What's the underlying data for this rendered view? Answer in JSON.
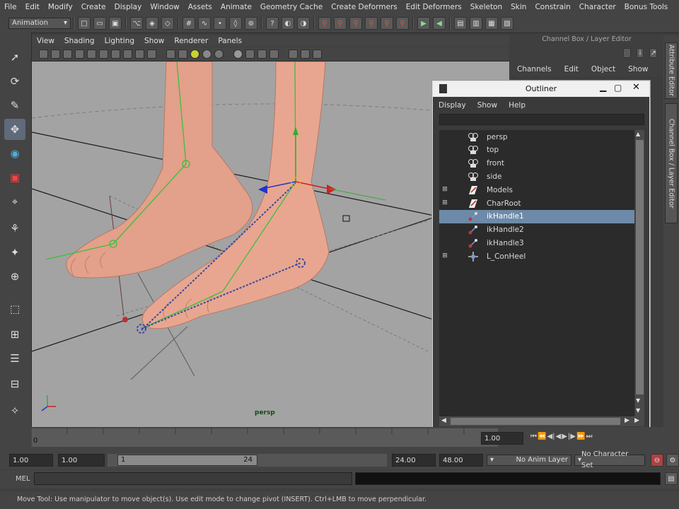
{
  "menubar": [
    "File",
    "Edit",
    "Modify",
    "Create",
    "Display",
    "Window",
    "Assets",
    "Animate",
    "Geometry Cache",
    "Create Deformers",
    "Edit Deformers",
    "Skeleton",
    "Skin",
    "Constrain",
    "Character",
    "Bonus Tools"
  ],
  "statusline": {
    "menuset": "Animation"
  },
  "panel": {
    "menus": [
      "View",
      "Shading",
      "Lighting",
      "Show",
      "Renderer",
      "Panels"
    ],
    "camera_label": "persp"
  },
  "channelbox": {
    "title": "Channel Box / Layer Editor",
    "menus": [
      "Channels",
      "Edit",
      "Object",
      "Show"
    ]
  },
  "side_tabs": [
    "Attribute Editor",
    "Channel Box / Layer Editor"
  ],
  "outliner": {
    "title": "Outliner",
    "menus": [
      "Display",
      "Show",
      "Help"
    ],
    "items": [
      {
        "label": "persp",
        "icon": "camera-icon",
        "expand": false,
        "selected": false
      },
      {
        "label": "top",
        "icon": "camera-icon",
        "expand": false,
        "selected": false
      },
      {
        "label": "front",
        "icon": "camera-icon",
        "expand": false,
        "selected": false
      },
      {
        "label": "side",
        "icon": "camera-icon",
        "expand": false,
        "selected": false
      },
      {
        "label": "Models",
        "icon": "group-icon",
        "expand": true,
        "selected": false
      },
      {
        "label": "CharRoot",
        "icon": "group-icon",
        "expand": true,
        "selected": false
      },
      {
        "label": "ikHandle1",
        "icon": "ik-handle-icon",
        "expand": false,
        "selected": true
      },
      {
        "label": "ikHandle2",
        "icon": "ik-handle-icon",
        "expand": false,
        "selected": false
      },
      {
        "label": "ikHandle3",
        "icon": "ik-handle-icon",
        "expand": false,
        "selected": false
      },
      {
        "label": "L_ConHeel",
        "icon": "locator-icon",
        "expand": true,
        "selected": false
      }
    ]
  },
  "timeline": {
    "start_label": "0",
    "current_time": "1.00"
  },
  "range": {
    "start_time": "1.00",
    "playback_start": "1.00",
    "slider_start": "1",
    "slider_end": "24",
    "playback_end": "24.00",
    "end_time": "48.00",
    "anim_layer": "No Anim Layer",
    "character_set": "No Character Set"
  },
  "cmdline": {
    "label": "MEL"
  },
  "helpline": {
    "text": "Move Tool: Use manipulator to move object(s). Use edit mode to change pivot (INSERT). Ctrl+LMB to move perpendicular."
  },
  "colors": {
    "selection": "#6d8aa8",
    "viewport_bg": "#a3a3a3",
    "skin": "#e8a690"
  }
}
